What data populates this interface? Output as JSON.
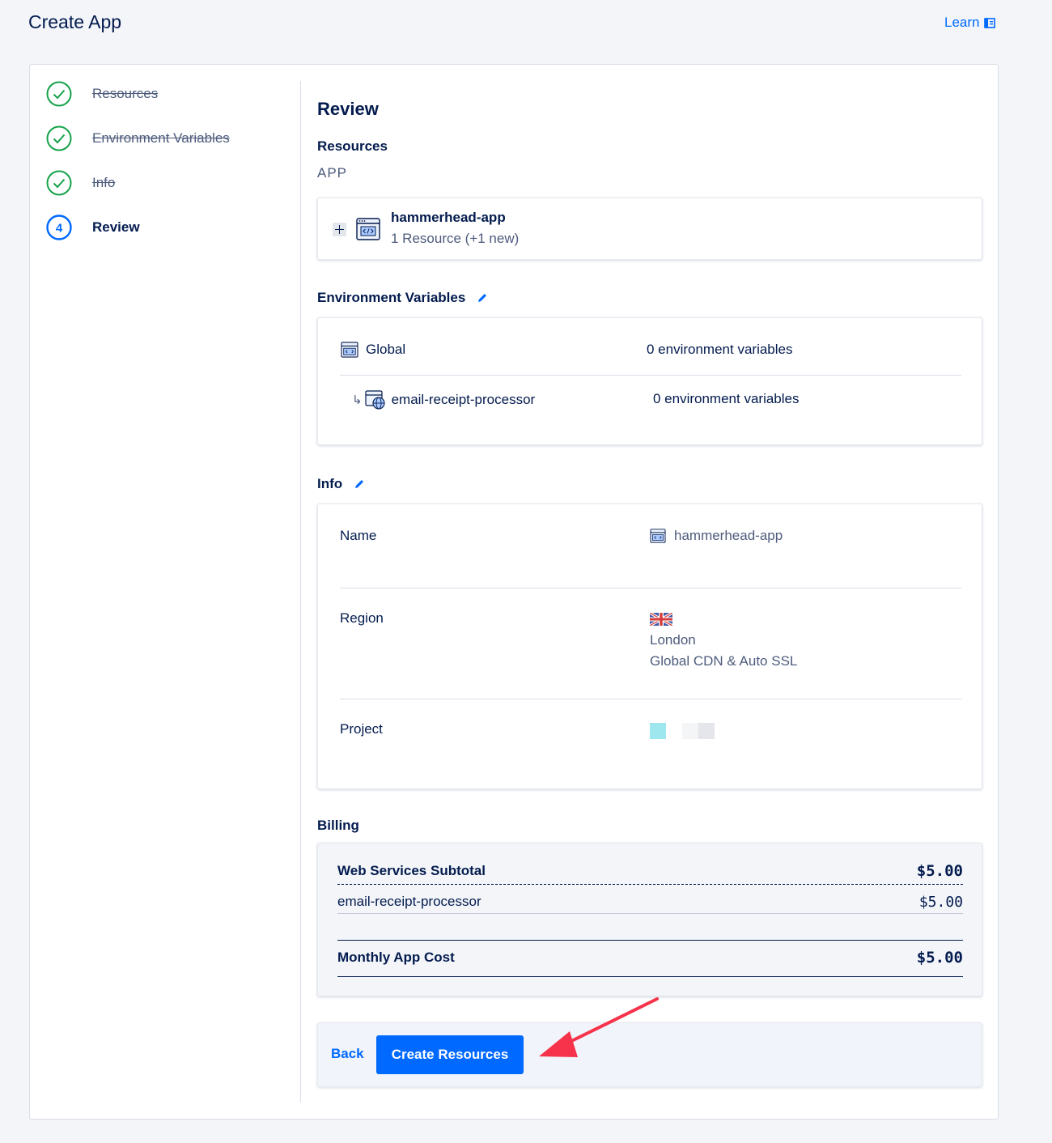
{
  "header": {
    "title": "Create App",
    "learn_label": "Learn"
  },
  "steps": [
    {
      "number": "",
      "label": "Resources",
      "status": "done"
    },
    {
      "number": "",
      "label": "Environment Variables",
      "status": "done"
    },
    {
      "number": "",
      "label": "Info",
      "status": "done"
    },
    {
      "number": "4",
      "label": "Review",
      "status": "current"
    }
  ],
  "review": {
    "title": "Review",
    "resources": {
      "heading": "Resources",
      "subheading": "APP",
      "app_name": "hammerhead-app",
      "app_meta": "1 Resource (+1 new)"
    },
    "env_vars": {
      "heading": "Environment Variables",
      "rows": [
        {
          "name": "Global",
          "count": "0 environment variables"
        },
        {
          "name": "email-receipt-processor",
          "count": "0 environment variables"
        }
      ]
    },
    "info": {
      "heading": "Info",
      "name_label": "Name",
      "name_value": "hammerhead-app",
      "region_label": "Region",
      "region_city": "London",
      "region_features": "Global CDN & Auto SSL",
      "project_label": "Project"
    },
    "billing": {
      "heading": "Billing",
      "subtotal_label": "Web Services Subtotal",
      "subtotal_amount": "$5.00",
      "item_label": "email-receipt-processor",
      "item_amount": "$5.00",
      "total_label": "Monthly App Cost",
      "total_amount": "$5.00"
    },
    "actions": {
      "back_label": "Back",
      "create_label": "Create Resources"
    }
  },
  "colors": {
    "accent": "#0069ff",
    "success": "#15a24a",
    "navy": "#031b4e",
    "annotation": "#f6334a"
  }
}
